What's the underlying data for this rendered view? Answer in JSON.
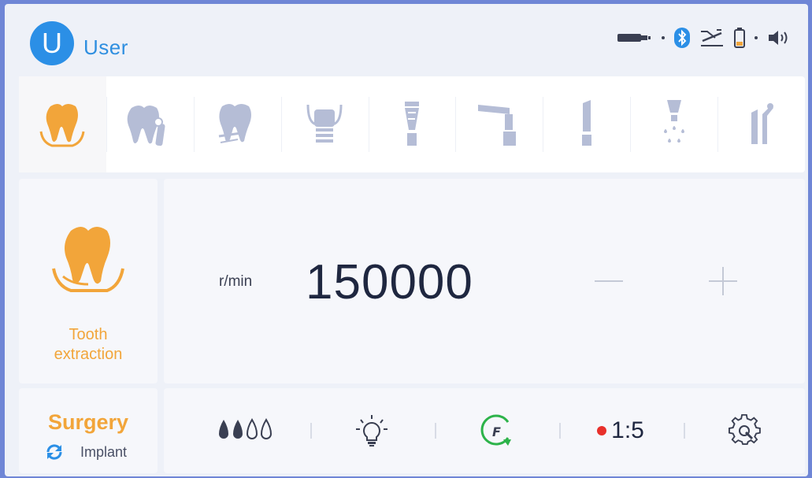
{
  "header": {
    "avatar_letter": "U",
    "user_name": "User",
    "status_icons": [
      "usb-plug-icon",
      "bluetooth-icon",
      "foot-pedal-icon",
      "battery-icon",
      "volume-icon"
    ]
  },
  "toolbar": {
    "tools": [
      {
        "icon": "tooth-extraction-icon",
        "active": true
      },
      {
        "icon": "tooth-cleaning-icon",
        "active": false
      },
      {
        "icon": "tooth-crack-icon",
        "active": false
      },
      {
        "icon": "implant-icon",
        "active": false
      },
      {
        "icon": "bur-icon",
        "active": false
      },
      {
        "icon": "contra-angle-icon",
        "active": false
      },
      {
        "icon": "straight-handpiece-icon",
        "active": false
      },
      {
        "icon": "water-spray-icon",
        "active": false
      },
      {
        "icon": "handpiece-pair-icon",
        "active": false
      }
    ]
  },
  "mode": {
    "label_line1": "Tooth",
    "label_line2": "extraction"
  },
  "speed": {
    "unit": "r/min",
    "value": "150000",
    "minus": "−",
    "plus": "+"
  },
  "surgery": {
    "title": "Surgery",
    "sub_label": "Implant"
  },
  "controls": {
    "water_level": 0.5,
    "ratio": "1:5",
    "direction_letter": "F"
  },
  "colors": {
    "accent_orange": "#f2a53a",
    "tool_inactive": "#b5bdd6",
    "brand_blue": "#2b8fe6",
    "green": "#2db34a",
    "red": "#e8302b"
  }
}
